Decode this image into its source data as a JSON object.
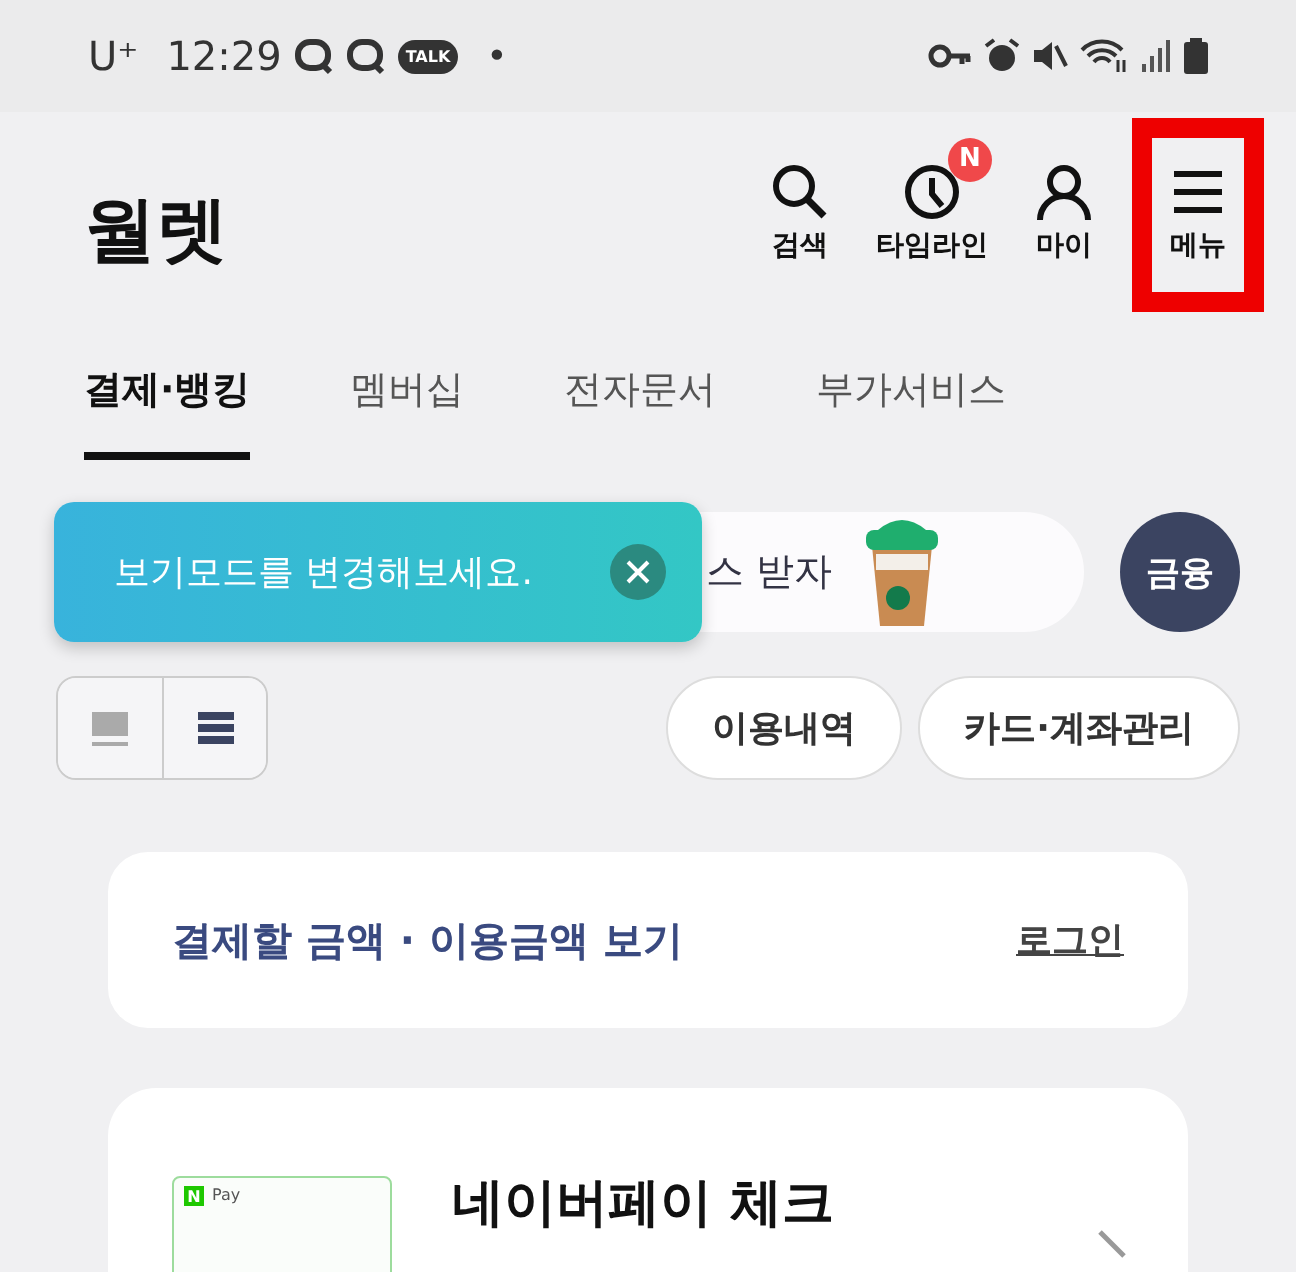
{
  "status_bar": {
    "carrier": "U⁺",
    "time": "12:29",
    "talk_badge": "TALK",
    "dot": "•"
  },
  "header": {
    "title": "월렛",
    "actions": [
      {
        "kind": "search",
        "label": "검색",
        "highlighted": false
      },
      {
        "kind": "timeline",
        "label": "타임라인",
        "badge": "N",
        "highlighted": false
      },
      {
        "kind": "my",
        "label": "마이",
        "highlighted": false
      },
      {
        "kind": "menu",
        "label": "메뉴",
        "highlighted": true
      }
    ]
  },
  "tabs": [
    {
      "label": "결제·뱅킹",
      "selected": true
    },
    {
      "label": "멤버십",
      "selected": false
    },
    {
      "label": "전자문서",
      "selected": false
    },
    {
      "label": "부가서비스",
      "selected": false
    }
  ],
  "banner": {
    "text": "스 받자",
    "finance_button": "금융"
  },
  "tooltip": {
    "text": "보기모드를 변경해보세요."
  },
  "view_modes": [
    {
      "kind": "card",
      "selected": false
    },
    {
      "kind": "list",
      "selected": true
    }
  ],
  "chips": [
    "이용내역",
    "카드·계좌관리"
  ],
  "payment_card": {
    "text": "결제할 금액 · 이용금액 보기",
    "link": "로그인"
  },
  "card_item": {
    "logo": "N",
    "brand": "Pay",
    "title": "네이버페이 체크"
  }
}
